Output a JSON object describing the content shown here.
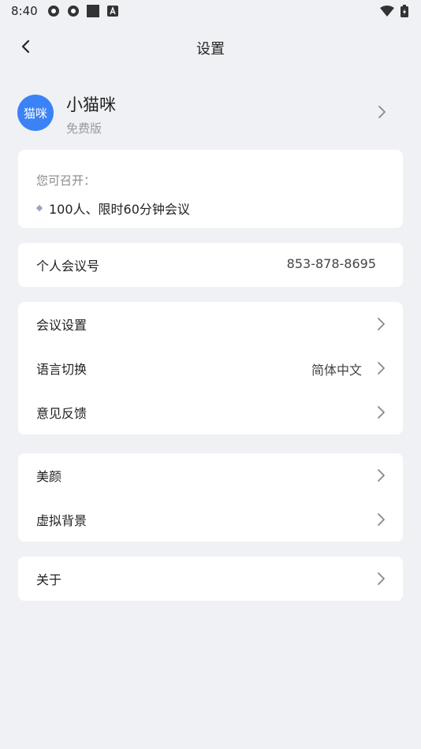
{
  "status_bar": {
    "time": "8:40"
  },
  "header": {
    "title": "设置"
  },
  "profile": {
    "avatar_text": "猫咪",
    "name": "小猫咪",
    "plan": "免费版"
  },
  "info": {
    "label": "您可召开：",
    "item": "100人、限时60分钟会议"
  },
  "personal_meeting": {
    "label": "个人会议号",
    "value": "853-878-8695"
  },
  "settings": {
    "meeting_settings": "会议设置",
    "language": {
      "label": "语言切换",
      "value": "简体中文"
    },
    "feedback": "意见反馈"
  },
  "beauty": {
    "beauty": "美颜",
    "virtual_background": "虚拟背景"
  },
  "about": {
    "label": "关于"
  },
  "colors": {
    "background": "#f0f1f5",
    "avatar": "#3b82f6",
    "card": "#ffffff"
  }
}
